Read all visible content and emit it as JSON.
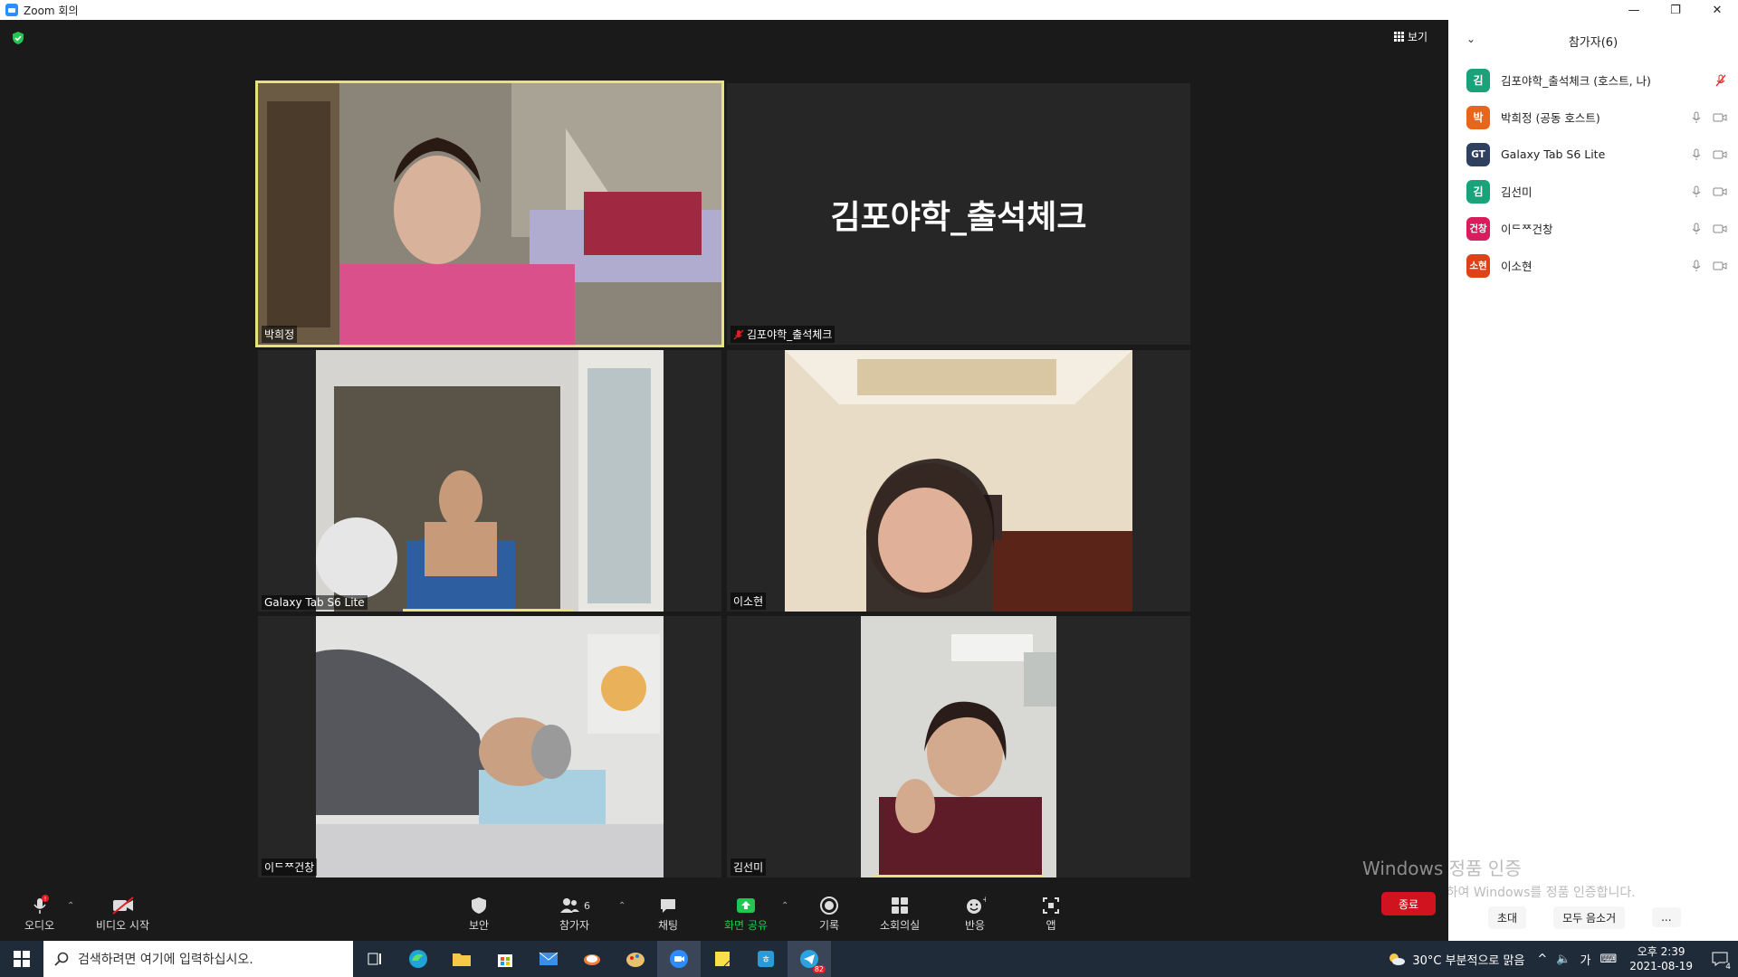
{
  "window": {
    "title": "Zoom 회의",
    "minimize": "—",
    "maximize": "❐",
    "close": "✕"
  },
  "meeting": {
    "view_label": "보기",
    "tiles": [
      {
        "name": "박희정",
        "active": true
      },
      {
        "name": "김포야학_출석체크",
        "card_title": "김포야학_출석체크",
        "muted": true
      },
      {
        "name": "Galaxy Tab S6 Lite"
      },
      {
        "name": "이소현"
      },
      {
        "name": "이ᄃᄍ건창"
      },
      {
        "name": "김선미"
      }
    ]
  },
  "participants_panel": {
    "title": "참가자(6)",
    "participants": [
      {
        "initials": "김",
        "name": "김포야학_출석체크 (호스트, 나)",
        "color": "#1aa37a",
        "mic": "muted",
        "video": "none"
      },
      {
        "initials": "박",
        "name": "박희정 (공동 호스트)",
        "color": "#e8651a",
        "mic": "on",
        "video": "on"
      },
      {
        "initials": "GT",
        "name": "Galaxy Tab S6 Lite",
        "color": "#2f3f5f",
        "mic": "on",
        "video": "on"
      },
      {
        "initials": "김",
        "name": "김선미",
        "color": "#1aa37a",
        "mic": "on",
        "video": "on"
      },
      {
        "initials": "건창",
        "name": "이ᄃᄍ건창",
        "color": "#d91c5c",
        "mic": "on",
        "video": "on"
      },
      {
        "initials": "소현",
        "name": "이소현",
        "color": "#e0401a",
        "mic": "on",
        "video": "on"
      }
    ],
    "invite_label": "초대",
    "mute_all_label": "모두 음소거",
    "more_label": "..."
  },
  "watermark": {
    "line1": "Windows 정품 인증",
    "line2": "[설정]으로 이동하여 Windows를 정품 인증합니다."
  },
  "toolbar": {
    "audio_label": "오디오",
    "video_label": "비디오 시작",
    "security_label": "보안",
    "participants_label": "참가자",
    "participants_count": "6",
    "chat_label": "채팅",
    "share_label": "화면 공유",
    "record_label": "기록",
    "breakout_label": "소회의실",
    "reactions_label": "반응",
    "apps_label": "앱",
    "end_label": "종료",
    "share_color": "#23c552",
    "end_color": "#d0131e"
  },
  "taskbar": {
    "search_placeholder": "검색하려면 여기에 입력하십시오.",
    "weather": "30°C  부분적으로 맑음",
    "ime": "가",
    "time": "오후 2:39",
    "date": "2021-08-19",
    "notification_count": "4",
    "teams_badge": "82"
  }
}
